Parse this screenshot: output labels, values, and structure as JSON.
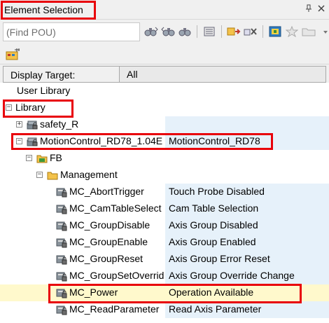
{
  "window": {
    "title": "Element Selection",
    "pin_glyph": "📌",
    "close_glyph": "✕"
  },
  "toolbar": {
    "find_placeholder": "(Find POU)",
    "icons": [
      "find-next-icon",
      "find-prev-icon",
      "binoculars-icon",
      "list-icon",
      "add-to-watch-icon",
      "remove-icon",
      "cpu-icon",
      "star-icon",
      "folder-icon",
      "dropdown-icon"
    ]
  },
  "toolbar2": {
    "icons": [
      "library-tree-icon"
    ]
  },
  "display_target": {
    "label": "Display Target:",
    "value": "All"
  },
  "tree": {
    "user_library": "User Library",
    "library": "Library",
    "safety": "safety_R",
    "motion_name": "MotionControl_RD78_1.04E",
    "motion_desc": "MotionControl_RD78",
    "fb": "FB",
    "management": "Management",
    "items": [
      {
        "name": "MC_AbortTrigger",
        "desc": "Touch Probe Disabled"
      },
      {
        "name": "MC_CamTableSelect",
        "desc": "Cam Table Selection"
      },
      {
        "name": "MC_GroupDisable",
        "desc": "Axis Group Disabled"
      },
      {
        "name": "MC_GroupEnable",
        "desc": "Axis Group Enabled"
      },
      {
        "name": "MC_GroupReset",
        "desc": "Axis Group Error Reset"
      },
      {
        "name": "MC_GroupSetOverride",
        "desc": "Axis Group Override Change"
      },
      {
        "name": "MC_Power",
        "desc": "Operation Available"
      },
      {
        "name": "MC_ReadParameter",
        "desc": "Read Axis Parameter"
      }
    ]
  },
  "colors": {
    "highlight": "#e8000a",
    "selected_row": "#fff9cc",
    "description_column": "#e6f1fa"
  }
}
